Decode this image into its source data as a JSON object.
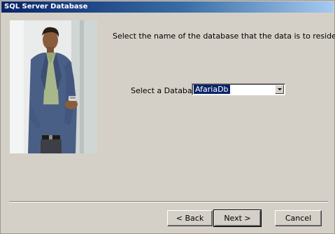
{
  "window": {
    "title": "SQL Server Database"
  },
  "content": {
    "instruction": "Select the name of the database that the data is to reside in.",
    "database_label": "Select a Database:",
    "database_selected": "AfariaDb"
  },
  "buttons": {
    "back": "< Back",
    "next": "Next >",
    "cancel": "Cancel"
  },
  "icons": {
    "combo_arrow": "chevron-down-icon",
    "photo": "businessman-photo"
  },
  "colors": {
    "selection": "#0a246a",
    "face": "#d4d0c8",
    "title_start": "#0a246a"
  }
}
